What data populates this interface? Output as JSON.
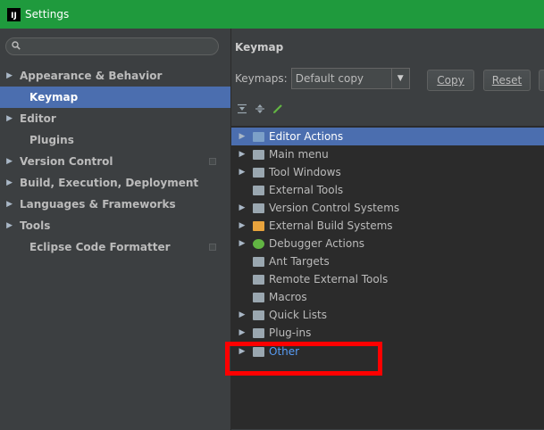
{
  "window": {
    "logo_text": "IJ",
    "title": "Settings",
    "titlebar_color": "#1f9a3d"
  },
  "sidebar": {
    "search_placeholder": "",
    "items": [
      {
        "label": "Appearance & Behavior",
        "expandable": true
      },
      {
        "label": "Keymap",
        "expandable": false,
        "selected": true
      },
      {
        "label": "Editor",
        "expandable": true
      },
      {
        "label": "Plugins",
        "expandable": false
      },
      {
        "label": "Version Control",
        "expandable": true
      },
      {
        "label": "Build, Execution, Deployment",
        "expandable": true
      },
      {
        "label": "Languages & Frameworks",
        "expandable": true
      },
      {
        "label": "Tools",
        "expandable": true
      },
      {
        "label": "Eclipse Code Formatter",
        "expandable": false
      }
    ],
    "arrow_glyph": "▶"
  },
  "main": {
    "title": "Keymap",
    "keymaps_label": "Keymaps:",
    "keymap_selected": "Default copy",
    "dropdown_glyph": "▼",
    "copy_button": "Copy",
    "reset_button": "Reset"
  },
  "tree": {
    "arrow_glyph": "▶",
    "items": [
      {
        "label": "Editor Actions",
        "expandable": true,
        "selected": true,
        "icon": "editor-actions-icon"
      },
      {
        "label": "Main menu",
        "expandable": true,
        "icon": "main-menu-icon"
      },
      {
        "label": "Tool Windows",
        "expandable": true,
        "icon": "folder-icon"
      },
      {
        "label": "External Tools",
        "expandable": false,
        "icon": "external-tools-icon"
      },
      {
        "label": "Version Control Systems",
        "expandable": true,
        "icon": "folder-icon"
      },
      {
        "label": "External Build Systems",
        "expandable": true,
        "icon": "build-systems-icon"
      },
      {
        "label": "Debugger Actions",
        "expandable": true,
        "icon": "bug-icon"
      },
      {
        "label": "Ant Targets",
        "expandable": false,
        "icon": "ant-targets-icon"
      },
      {
        "label": "Remote External Tools",
        "expandable": false,
        "icon": "remote-tools-icon"
      },
      {
        "label": "Macros",
        "expandable": false,
        "icon": "folder-icon"
      },
      {
        "label": "Quick Lists",
        "expandable": true,
        "icon": "folder-icon"
      },
      {
        "label": "Plug-ins",
        "expandable": true,
        "icon": "folder-icon"
      },
      {
        "label": "Other",
        "expandable": true,
        "icon": "other-icon",
        "highlighted": true
      }
    ]
  },
  "colors": {
    "selection": "#4b6eaf",
    "link_blue": "#589df6",
    "annotation_red": "#ff0000"
  }
}
